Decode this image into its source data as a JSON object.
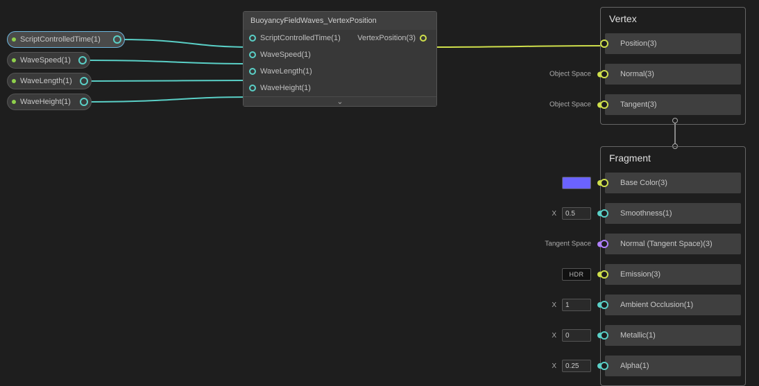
{
  "params": [
    {
      "label": "ScriptControlledTime(1)"
    },
    {
      "label": "WaveSpeed(1)"
    },
    {
      "label": "WaveLength(1)"
    },
    {
      "label": "WaveHeight(1)"
    }
  ],
  "node": {
    "title": "BuoyancyFieldWaves_VertexPosition",
    "inputs": [
      "ScriptControlledTime(1)",
      "WaveSpeed(1)",
      "WaveLength(1)",
      "WaveHeight(1)"
    ],
    "outputs": [
      "VertexPosition(3)"
    ],
    "expand_glyph": "⌄"
  },
  "vertex": {
    "title": "Vertex",
    "slots": [
      {
        "label": "Position(3)",
        "ctrl": null,
        "port": "yellow"
      },
      {
        "label": "Normal(3)",
        "ctrl": {
          "type": "space",
          "text": "Object Space"
        },
        "port": "yellow"
      },
      {
        "label": "Tangent(3)",
        "ctrl": {
          "type": "space",
          "text": "Object Space"
        },
        "port": "yellow"
      }
    ]
  },
  "fragment": {
    "title": "Fragment",
    "slots": [
      {
        "label": "Base Color(3)",
        "ctrl": {
          "type": "color",
          "value": "#6b63ff"
        },
        "port": "yellow"
      },
      {
        "label": "Smoothness(1)",
        "ctrl": {
          "type": "number",
          "x": "X",
          "value": "0.5"
        },
        "port": "cyan"
      },
      {
        "label": "Normal (Tangent Space)(3)",
        "ctrl": {
          "type": "space",
          "text": "Tangent Space"
        },
        "port": "purple"
      },
      {
        "label": "Emission(3)",
        "ctrl": {
          "type": "hdr",
          "text": "HDR"
        },
        "port": "yellow"
      },
      {
        "label": "Ambient Occlusion(1)",
        "ctrl": {
          "type": "number",
          "x": "X",
          "value": "1"
        },
        "port": "cyan"
      },
      {
        "label": "Metallic(1)",
        "ctrl": {
          "type": "number",
          "x": "X",
          "value": "0"
        },
        "port": "cyan"
      },
      {
        "label": "Alpha(1)",
        "ctrl": {
          "type": "number",
          "x": "X",
          "value": "0.25"
        },
        "port": "cyan"
      }
    ]
  }
}
